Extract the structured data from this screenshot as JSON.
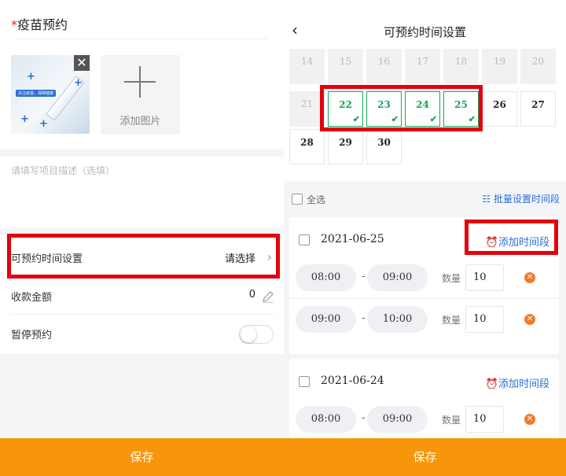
{
  "left": {
    "required_mark": "*",
    "title": "疫苗预约",
    "thumb_banner": "关注疫苗，保障健康",
    "close_glyph": "✕",
    "add_image_label": "添加图片",
    "description_placeholder": "请填写项目描述（选填）",
    "rows": [
      {
        "label": "可预约时间设置",
        "value": "请选择"
      },
      {
        "label": "收款金额",
        "value": "0"
      },
      {
        "label": "暂停预约",
        "value": ""
      }
    ],
    "save_label": "保存"
  },
  "right": {
    "back_glyph": "‹",
    "title": "可预约时间设置",
    "calendar": {
      "weeks": [
        [
          {
            "d": "14",
            "s": "disabled"
          },
          {
            "d": "15",
            "s": "disabled"
          },
          {
            "d": "16",
            "s": "disabled"
          },
          {
            "d": "17",
            "s": "disabled"
          },
          {
            "d": "18",
            "s": "disabled"
          },
          {
            "d": "19",
            "s": "disabled"
          },
          {
            "d": "20",
            "s": "disabled"
          }
        ],
        [
          {
            "d": "21",
            "s": "disabled"
          },
          {
            "d": "22",
            "s": "selected"
          },
          {
            "d": "23",
            "s": "selected"
          },
          {
            "d": "24",
            "s": "selected"
          },
          {
            "d": "25",
            "s": "selected"
          },
          {
            "d": "26",
            "s": "normal"
          },
          {
            "d": "27",
            "s": "normal"
          }
        ],
        [
          {
            "d": "28",
            "s": "normal"
          },
          {
            "d": "29",
            "s": "normal"
          },
          {
            "d": "30",
            "s": "normal"
          }
        ]
      ],
      "check_glyph": "✔"
    },
    "select_all_label": "全选",
    "batch_label": "☷ 批量设置时间段",
    "qty_label": "数量",
    "add_period_label": "⏰添加时间段",
    "delete_glyph": "✕",
    "dash": "-",
    "days": [
      {
        "date": "2021-06-25",
        "slots": [
          {
            "start": "08:00",
            "end": "09:00",
            "qty": "10"
          },
          {
            "start": "09:00",
            "end": "10:00",
            "qty": "10"
          }
        ]
      },
      {
        "date": "2021-06-24",
        "slots": [
          {
            "start": "08:00",
            "end": "09:00",
            "qty": "10"
          }
        ]
      }
    ],
    "save_label": "保存"
  },
  "colors": {
    "accent_orange": "#f7960b",
    "link_blue": "#2a6dd9",
    "selected_green": "#19a35a",
    "highlight_red": "#e3000b"
  }
}
